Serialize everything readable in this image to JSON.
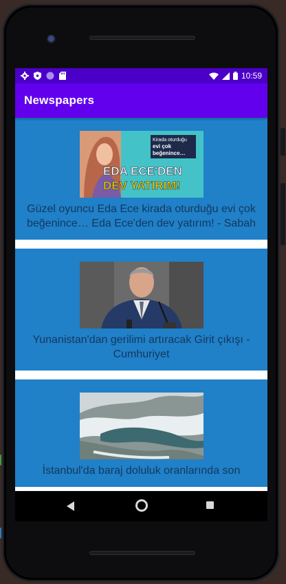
{
  "statusbar": {
    "time": "10:59",
    "left_icons": [
      "gear-icon",
      "shield-icon",
      "circle-icon",
      "sd-card-icon"
    ],
    "right_icons": [
      "wifi-icon",
      "signal-icon",
      "battery-icon"
    ]
  },
  "app": {
    "title": "Newspapers",
    "primary_color": "#6200ee",
    "status_color": "#4b00c8",
    "card_color": "#2080c8"
  },
  "articles": [
    {
      "headline": "Güzel oyuncu Eda Ece kirada oturduğu evi çok beğenince… Eda Ece'den dev yatırım! - Sabah",
      "image_caption_top": "Kirada oturduğu",
      "image_caption_mid": "evi çok",
      "image_caption_bot": "beğenince…",
      "image_title_1": "EDA ECE'DEN",
      "image_title_2": "DEV YATIRIM!"
    },
    {
      "headline": "Yunanistan'dan gerilimi artıracak Girit çıkışı - Cumhuriyet"
    },
    {
      "headline": "İstanbul'da baraj doluluk oranlarında son"
    }
  ]
}
